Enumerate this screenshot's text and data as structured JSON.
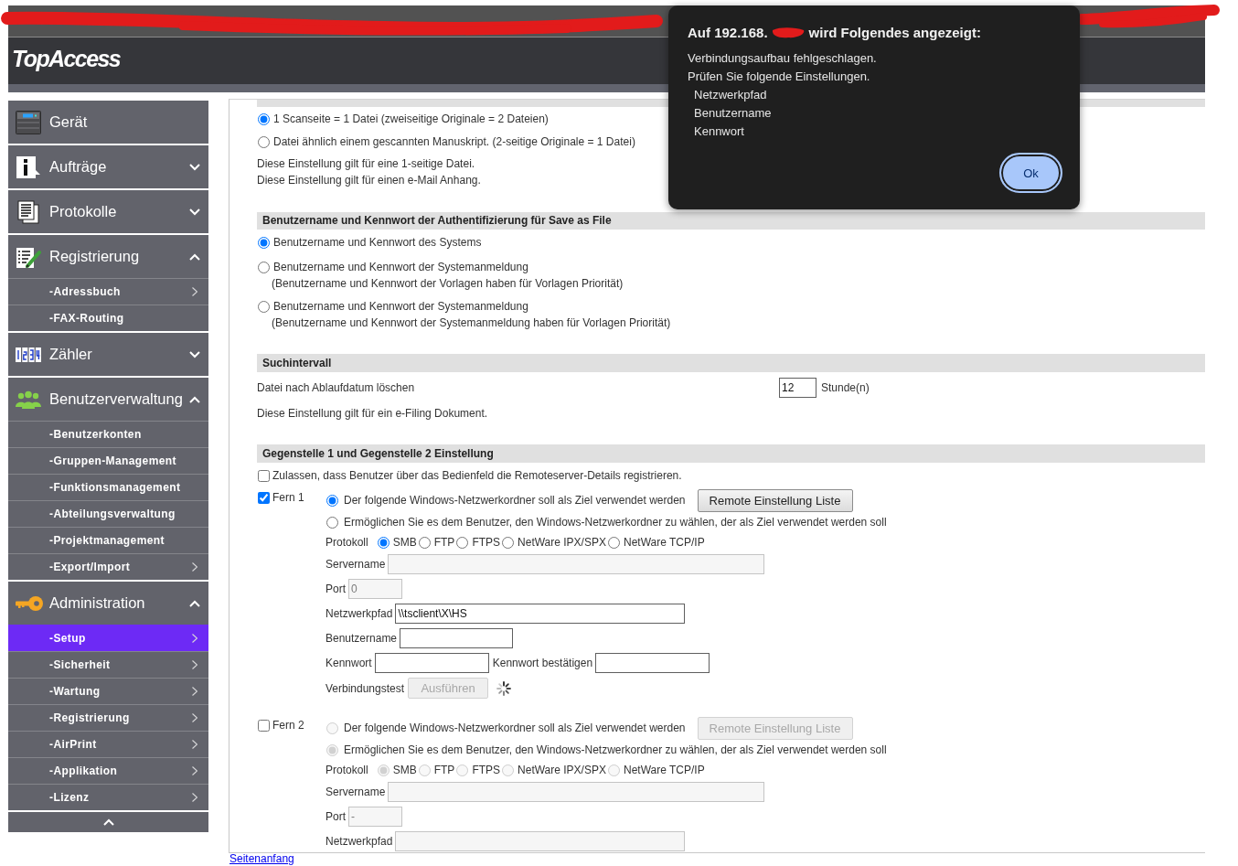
{
  "header": {
    "logo": "TopAccess"
  },
  "sidebar": {
    "items": [
      {
        "label": "Gerät",
        "kind": "device"
      },
      {
        "label": "Aufträge",
        "kind": "jobs",
        "expanded": false
      },
      {
        "label": "Protokolle",
        "kind": "logs",
        "expanded": false
      },
      {
        "label": "Registrierung",
        "kind": "registration",
        "expanded": true,
        "children": [
          {
            "label": "-Adressbuch",
            "submenu": true,
            "selected": false
          },
          {
            "label": "-FAX-Routing",
            "submenu": false,
            "selected": false
          }
        ]
      },
      {
        "label": "Zähler",
        "kind": "counter",
        "expanded": false
      },
      {
        "label": "Benutzerverwaltung",
        "kind": "users",
        "expanded": true,
        "children": [
          {
            "label": "-Benutzerkonten",
            "submenu": false,
            "selected": false
          },
          {
            "label": "-Gruppen-Management",
            "submenu": false,
            "selected": false
          },
          {
            "label": "-Funktionsmanagement",
            "submenu": false,
            "selected": false
          },
          {
            "label": "-Abteilungsverwaltung",
            "submenu": false,
            "selected": false
          },
          {
            "label": "-Projektmanagement",
            "submenu": false,
            "selected": false
          },
          {
            "label": "-Export/Import",
            "submenu": true,
            "selected": false
          }
        ]
      },
      {
        "label": "Administration",
        "kind": "administration",
        "expanded": true,
        "children": [
          {
            "label": "-Setup",
            "submenu": true,
            "selected": true
          },
          {
            "label": "-Sicherheit",
            "submenu": true,
            "selected": false
          },
          {
            "label": "-Wartung",
            "submenu": true,
            "selected": false
          },
          {
            "label": "-Registrierung",
            "submenu": true,
            "selected": false
          },
          {
            "label": "-AirPrint",
            "submenu": true,
            "selected": false
          },
          {
            "label": "-Applikation",
            "submenu": true,
            "selected": false
          },
          {
            "label": "-Lizenz",
            "submenu": true,
            "selected": false
          }
        ]
      }
    ]
  },
  "content": {
    "file_split": {
      "options": [
        {
          "label": "1 Scanseite = 1 Datei (zweiseitige Originale = 2 Dateien)",
          "selected": true
        },
        {
          "label": "Datei ähnlich einem gescannten Manuskript. (2-seitige Originale = 1 Datei)",
          "selected": false
        }
      ],
      "notes": [
        "Diese Einstellung gilt für eine 1-seitige Datei.",
        "Diese Einstellung gilt für einen e-Mail Anhang."
      ]
    },
    "auth": {
      "title": "Benutzername und Kennwort der Authentifizierung für Save as File",
      "options": [
        {
          "label": "Benutzername und Kennwort des Systems",
          "selected": true
        },
        {
          "label": "Benutzername und Kennwort der Systemanmeldung",
          "note": "(Benutzername und Kennwort der Vorlagen haben für Vorlagen Priorität)",
          "selected": false
        },
        {
          "label": "Benutzername und Kennwort der Systemanmeldung",
          "note": "(Benutzername und Kennwort der Systemanmeldung haben für Vorlagen Priorität)",
          "selected": false
        }
      ]
    },
    "search_interval": {
      "title": "Suchintervall",
      "label": "Datei nach Ablaufdatum löschen",
      "value": "12",
      "unit": "Stunde(n)",
      "note": "Diese Einstellung gilt für ein e-Filing Dokument."
    },
    "remote": {
      "title": "Gegenstelle 1 und Gegenstelle 2 Einstellung",
      "allow": {
        "label": "Zulassen, dass Benutzer über das Bedienfeld die Remoteserver-Details registrieren.",
        "checked": false
      },
      "destinations": [
        {
          "label": "Fern 1",
          "checked": true,
          "disabled": false,
          "targets": [
            {
              "label": "Der folgende Windows-Netzwerkordner soll als Ziel verwendet werden",
              "selected": true
            },
            {
              "label": "Ermöglichen Sie es dem Benutzer, den Windows-Netzwerkordner zu wählen, der als Ziel verwendet werden soll",
              "selected": false
            }
          ],
          "list_button": "Remote Einstellung Liste",
          "protocol_label": "Protokoll",
          "protocols": [
            {
              "label": "SMB",
              "selected": true
            },
            {
              "label": "FTP",
              "selected": false
            },
            {
              "label": "FTPS",
              "selected": false
            },
            {
              "label": "NetWare IPX/SPX",
              "selected": false
            },
            {
              "label": "NetWare TCP/IP",
              "selected": false
            }
          ],
          "rows": [
            {
              "fields": [
                {
                  "label": "Servername",
                  "kind": "server",
                  "disabled": true
                }
              ]
            },
            {
              "fields": [
                {
                  "label": "Port",
                  "kind": "port",
                  "value": "0",
                  "disabled": true
                }
              ]
            },
            {
              "fields": [
                {
                  "label": "Netzwerkpfad",
                  "kind": "path",
                  "value": "\\\\tsclient\\X\\HS",
                  "disabled": false
                }
              ]
            },
            {
              "fields": [
                {
                  "label": "Benutzername",
                  "kind": "text",
                  "disabled": false
                }
              ]
            },
            {
              "fields": [
                {
                  "label": "Kennwort",
                  "kind": "password",
                  "disabled": false
                },
                {
                  "label": "Kennwort bestätigen",
                  "kind": "password",
                  "disabled": false
                }
              ]
            }
          ],
          "test": {
            "label": "Verbindungstest",
            "button": "Ausführen",
            "disabled": true,
            "busy": true
          }
        },
        {
          "label": "Fern 2",
          "checked": false,
          "disabled": true,
          "targets": [
            {
              "label": "Der folgende Windows-Netzwerkordner soll als Ziel verwendet werden",
              "selected": false
            },
            {
              "label": "Ermöglichen Sie es dem Benutzer, den Windows-Netzwerkordner zu wählen, der als Ziel verwendet werden soll",
              "selected": true
            }
          ],
          "list_button": "Remote Einstellung Liste",
          "protocol_label": "Protokoll",
          "protocols": [
            {
              "label": "SMB",
              "selected": true
            },
            {
              "label": "FTP",
              "selected": false
            },
            {
              "label": "FTPS",
              "selected": false
            },
            {
              "label": "NetWare IPX/SPX",
              "selected": false
            },
            {
              "label": "NetWare TCP/IP",
              "selected": false
            }
          ],
          "rows": [
            {
              "fields": [
                {
                  "label": "Servername",
                  "kind": "server",
                  "disabled": true
                }
              ]
            },
            {
              "fields": [
                {
                  "label": "Port",
                  "kind": "port",
                  "value": "-",
                  "disabled": true
                }
              ]
            },
            {
              "fields": [
                {
                  "label": "Netzwerkpfad",
                  "kind": "path",
                  "disabled": true
                }
              ]
            }
          ]
        }
      ]
    },
    "footer_link": "Seitenanfang"
  },
  "dialog": {
    "title_before": "Auf 192.168.",
    "title_after": "wird Folgendes angezeigt:",
    "message": [
      "Verbindungsaufbau fehlgeschlagen.",
      "Prüfen Sie folgende Einstellungen."
    ],
    "items": [
      "Netzwerkpfad",
      "Benutzername",
      "Kennwort"
    ],
    "button": "Ok"
  }
}
